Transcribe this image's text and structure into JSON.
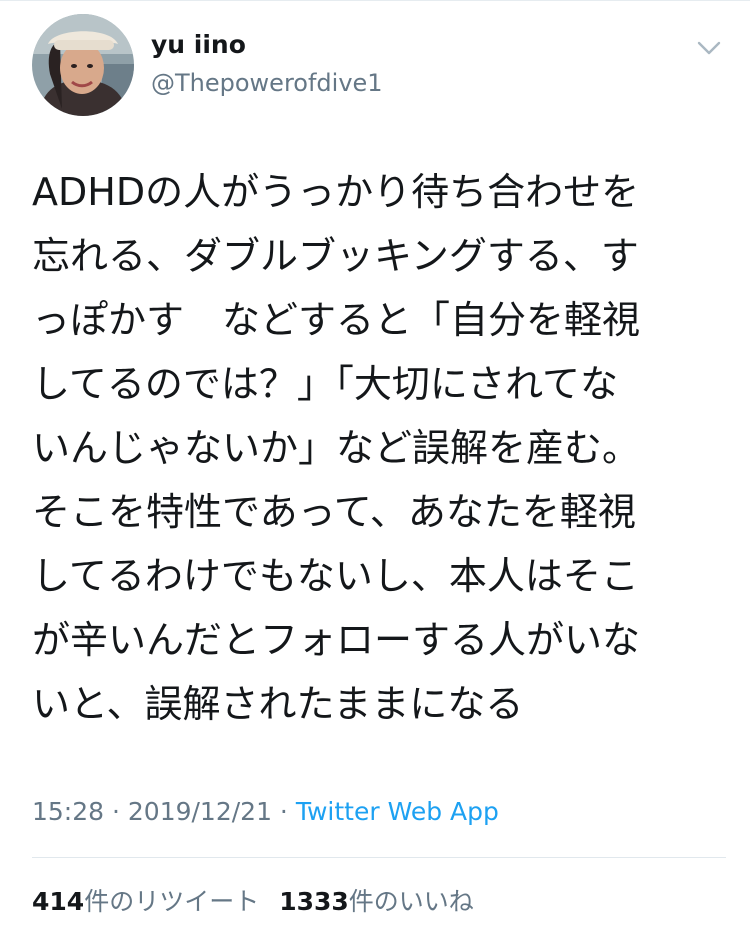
{
  "user": {
    "name": "yu iino",
    "handle": "@Thepowerofdive1"
  },
  "tweet": {
    "lines": [
      "ADHDの人がうっかり待ち合わせを",
      "忘れる、ダブルブッキングする、す",
      "っぽかす　などすると「自分を軽視",
      "してるのでは？」「大切にされてな",
      "いんじゃないか」など誤解を産む。",
      "そこを特性であって、あなたを軽視",
      "してるわけでもないし、本人はそこ",
      "が辛いんだとフォローする人がいな",
      "いと、誤解されたままになる"
    ]
  },
  "meta": {
    "time": "15:28",
    "separator": " · ",
    "date": "2019/12/21",
    "source": "Twitter Web App"
  },
  "stats": {
    "retweets_count": "414",
    "retweets_label": "件のリツイート",
    "likes_count": "1333",
    "likes_label": "件のいいね"
  },
  "icons": {
    "menu": "chevron-down-icon"
  },
  "colors": {
    "text": "#14171a",
    "secondary": "#657786",
    "link": "#1da1f2",
    "divider": "#e1e8ed"
  }
}
